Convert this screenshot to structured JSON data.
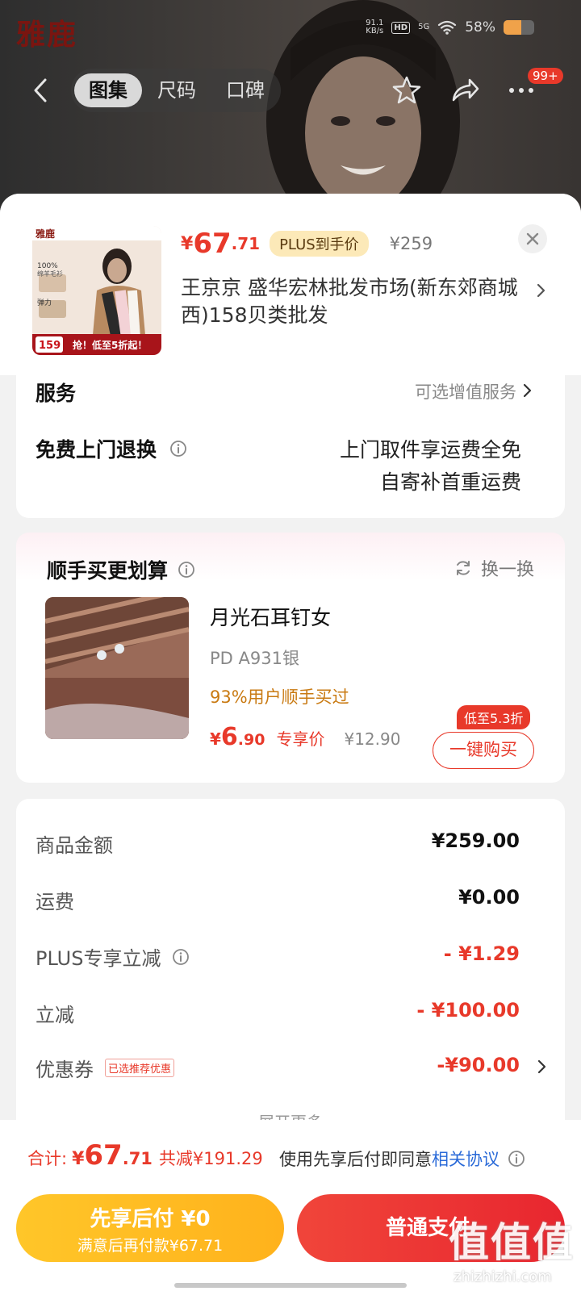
{
  "brand": {
    "logo_text": "雅鹿",
    "logo_v": "V",
    "reg": "®"
  },
  "status_bar": {
    "speed_top": "91.1",
    "speed_bottom": "KB/s",
    "hd": "HD",
    "network": "5G",
    "battery": "58%",
    "battery_level": 0.58
  },
  "nav": {
    "tabs": [
      {
        "label": "图集",
        "active": true
      },
      {
        "label": "尺码"
      },
      {
        "label": "口碑"
      }
    ],
    "message_badge": "99+",
    "icons": [
      "back-icon",
      "star-icon",
      "share-icon",
      "more-icon"
    ]
  },
  "product": {
    "thumb": {
      "line1": "100%",
      "line2": "绵羊毛衫",
      "line3": "弹力",
      "price_tag": "159",
      "banner": "抢！低至5折起！"
    },
    "currency": "¥",
    "price_int": "67",
    "price_dec": ".71",
    "plus_label": "PLUS到手价",
    "original_price": "¥259",
    "address": "王京京  盛华宏林批发市场(新东郊商城西)158贝类批发"
  },
  "service": {
    "title": "服务",
    "optional_label": "可选增值服务",
    "return_label": "免费上门退换",
    "return_desc_1": "上门取件享运费全免",
    "return_desc_2": "自寄补首重运费"
  },
  "addon": {
    "title": "顺手买更划算",
    "swap_label": "换一换",
    "name": "月光石耳钉女",
    "sku": "PD A931银",
    "bought_pct": "93%用户顺手买过",
    "currency": "¥",
    "price_int": "6",
    "price_dec": ".90",
    "price_tag": "专享价",
    "original_price": "¥12.90",
    "discount_badge": "低至5.3折",
    "buy_button": "一键购买"
  },
  "fees": {
    "rows": [
      {
        "label": "商品金额",
        "value": "¥259.00"
      },
      {
        "label": "运费",
        "value": "¥0.00"
      },
      {
        "label": "PLUS专享立减",
        "value": "- ¥1.29"
      },
      {
        "label": "立减",
        "value": "- ¥100.00"
      },
      {
        "label": "优惠券",
        "value": "-¥90.00",
        "tag": "已选推荐优惠"
      }
    ],
    "expand_label": "展开更多"
  },
  "bottom": {
    "total_label": "合计:",
    "currency": "¥",
    "total_int": "67",
    "total_dec": ".71",
    "saved": "共减¥191.29",
    "agree_text": "使用先享后付即同意",
    "agree_link": "相关协议",
    "pay_later_line1": "先享后付 ¥0",
    "pay_later_line2": "满意后再付款¥67.71",
    "pay_normal": "普通支付",
    "watermark_big": "值值值",
    "watermark_small": "zhizhizhi.com"
  },
  "colors": {
    "accent_red": "#e8392a",
    "plus_gold": "#fce9b8",
    "pay_later_yellow": "#ffc629",
    "link_blue": "#2a6ad8"
  }
}
